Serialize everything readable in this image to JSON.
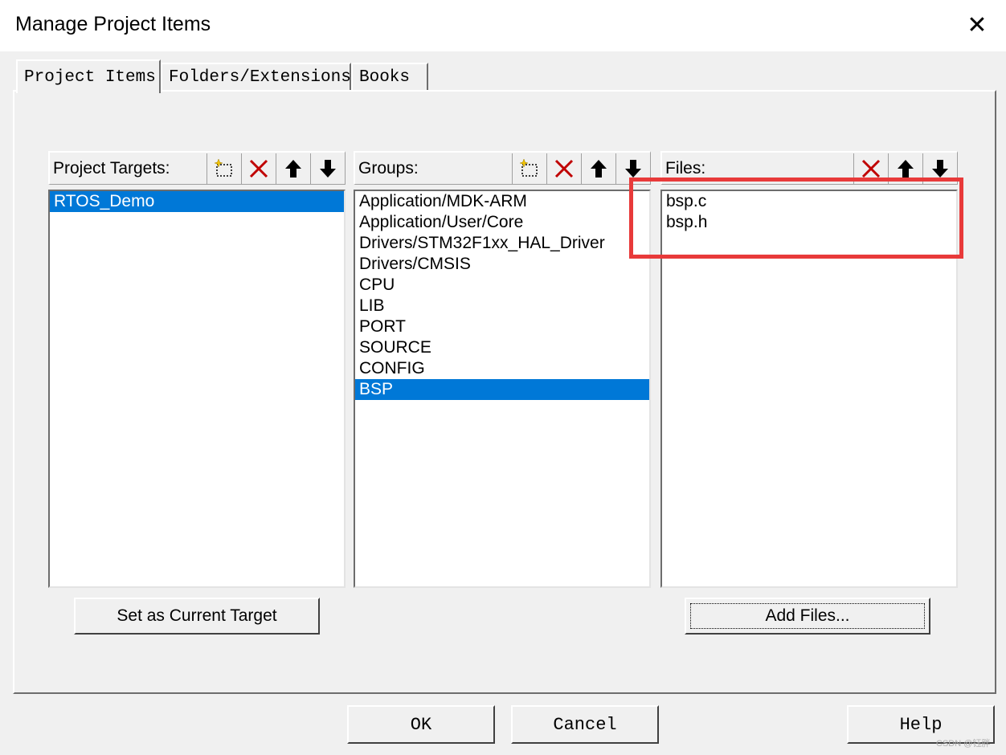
{
  "dialog": {
    "title": "Manage Project Items",
    "close_glyph": "✕"
  },
  "tabs": [
    {
      "label": "Project Items",
      "active": true
    },
    {
      "label": "Folders/Extensions",
      "active": false
    },
    {
      "label": "Books",
      "active": false
    }
  ],
  "targets": {
    "header": "Project Targets:",
    "items": [
      "RTOS_Demo"
    ],
    "selected": "RTOS_Demo",
    "button_label": "Set as Current Target"
  },
  "groups": {
    "header": "Groups:",
    "items": [
      "Application/MDK-ARM",
      "Application/User/Core",
      "Drivers/STM32F1xx_HAL_Driver",
      "Drivers/CMSIS",
      "CPU",
      "LIB",
      "PORT",
      "SOURCE",
      "CONFIG",
      "BSP"
    ],
    "selected": "BSP"
  },
  "files": {
    "header": "Files:",
    "items": [
      "bsp.c",
      "bsp.h"
    ],
    "button_label": "Add Files..."
  },
  "footer": {
    "ok": "OK",
    "cancel": "Cancel",
    "help": "Help"
  },
  "icons": {
    "new": "new-item-icon",
    "delete": "delete-icon",
    "up": "move-up-icon",
    "down": "move-down-icon"
  },
  "colors": {
    "selection": "#0078d7",
    "annotation": "#e83a3a",
    "delete_red": "#c00000"
  },
  "watermark": "CSDN @钰胖"
}
